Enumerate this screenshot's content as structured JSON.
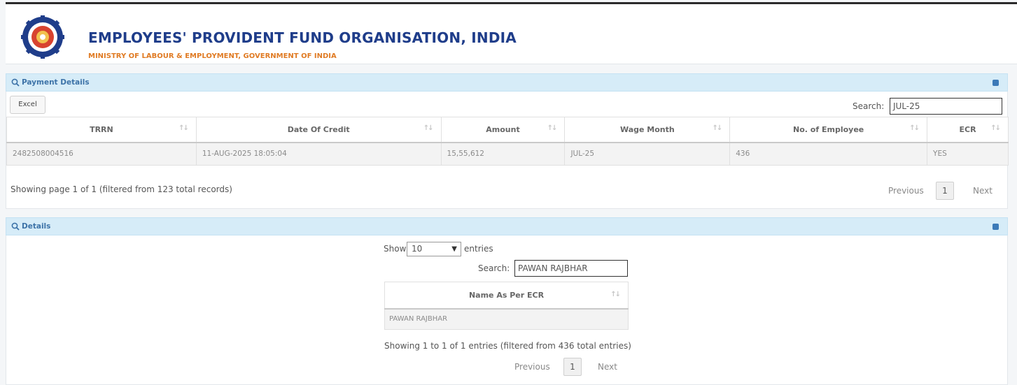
{
  "header": {
    "title": "EMPLOYEES' PROVIDENT FUND ORGANISATION, INDIA",
    "subtitle": "MINISTRY OF LABOUR & EMPLOYMENT, GOVERNMENT OF INDIA",
    "logo_icon": "epfo-logo-icon"
  },
  "payment_panel": {
    "title": "Payment Details",
    "excel_label": "Excel",
    "search_label": "Search:",
    "search_value": "JUL-25",
    "columns": [
      "TRRN",
      "Date Of Credit",
      "Amount",
      "Wage Month",
      "No. of Employee",
      "ECR"
    ],
    "rows": [
      [
        "2482508004516",
        "11-AUG-2025 18:05:04",
        "15,55,612",
        "JUL-25",
        "436",
        "YES"
      ]
    ],
    "info": "Showing page 1 of 1 (filtered from 123 total records)",
    "pagination": {
      "previous": "Previous",
      "page": "1",
      "next": "Next"
    }
  },
  "details_panel": {
    "title": "Details",
    "show_label": "Show",
    "entries_value": "10",
    "entries_label": "entries",
    "search_label": "Search:",
    "search_value": "PAWAN RAJBHAR",
    "columns": [
      "Name As Per ECR"
    ],
    "rows": [
      [
        "PAWAN RAJBHAR"
      ]
    ],
    "info": "Showing 1 to 1 of 1 entries (filtered from 436 total entries)",
    "pagination": {
      "previous": "Previous",
      "page": "1",
      "next": "Next"
    }
  },
  "colors": {
    "title_blue": "#1f3d8a",
    "subtitle_orange": "#e07b24",
    "panel_header": "#d6ecf8",
    "link": "#3a7bc8"
  }
}
